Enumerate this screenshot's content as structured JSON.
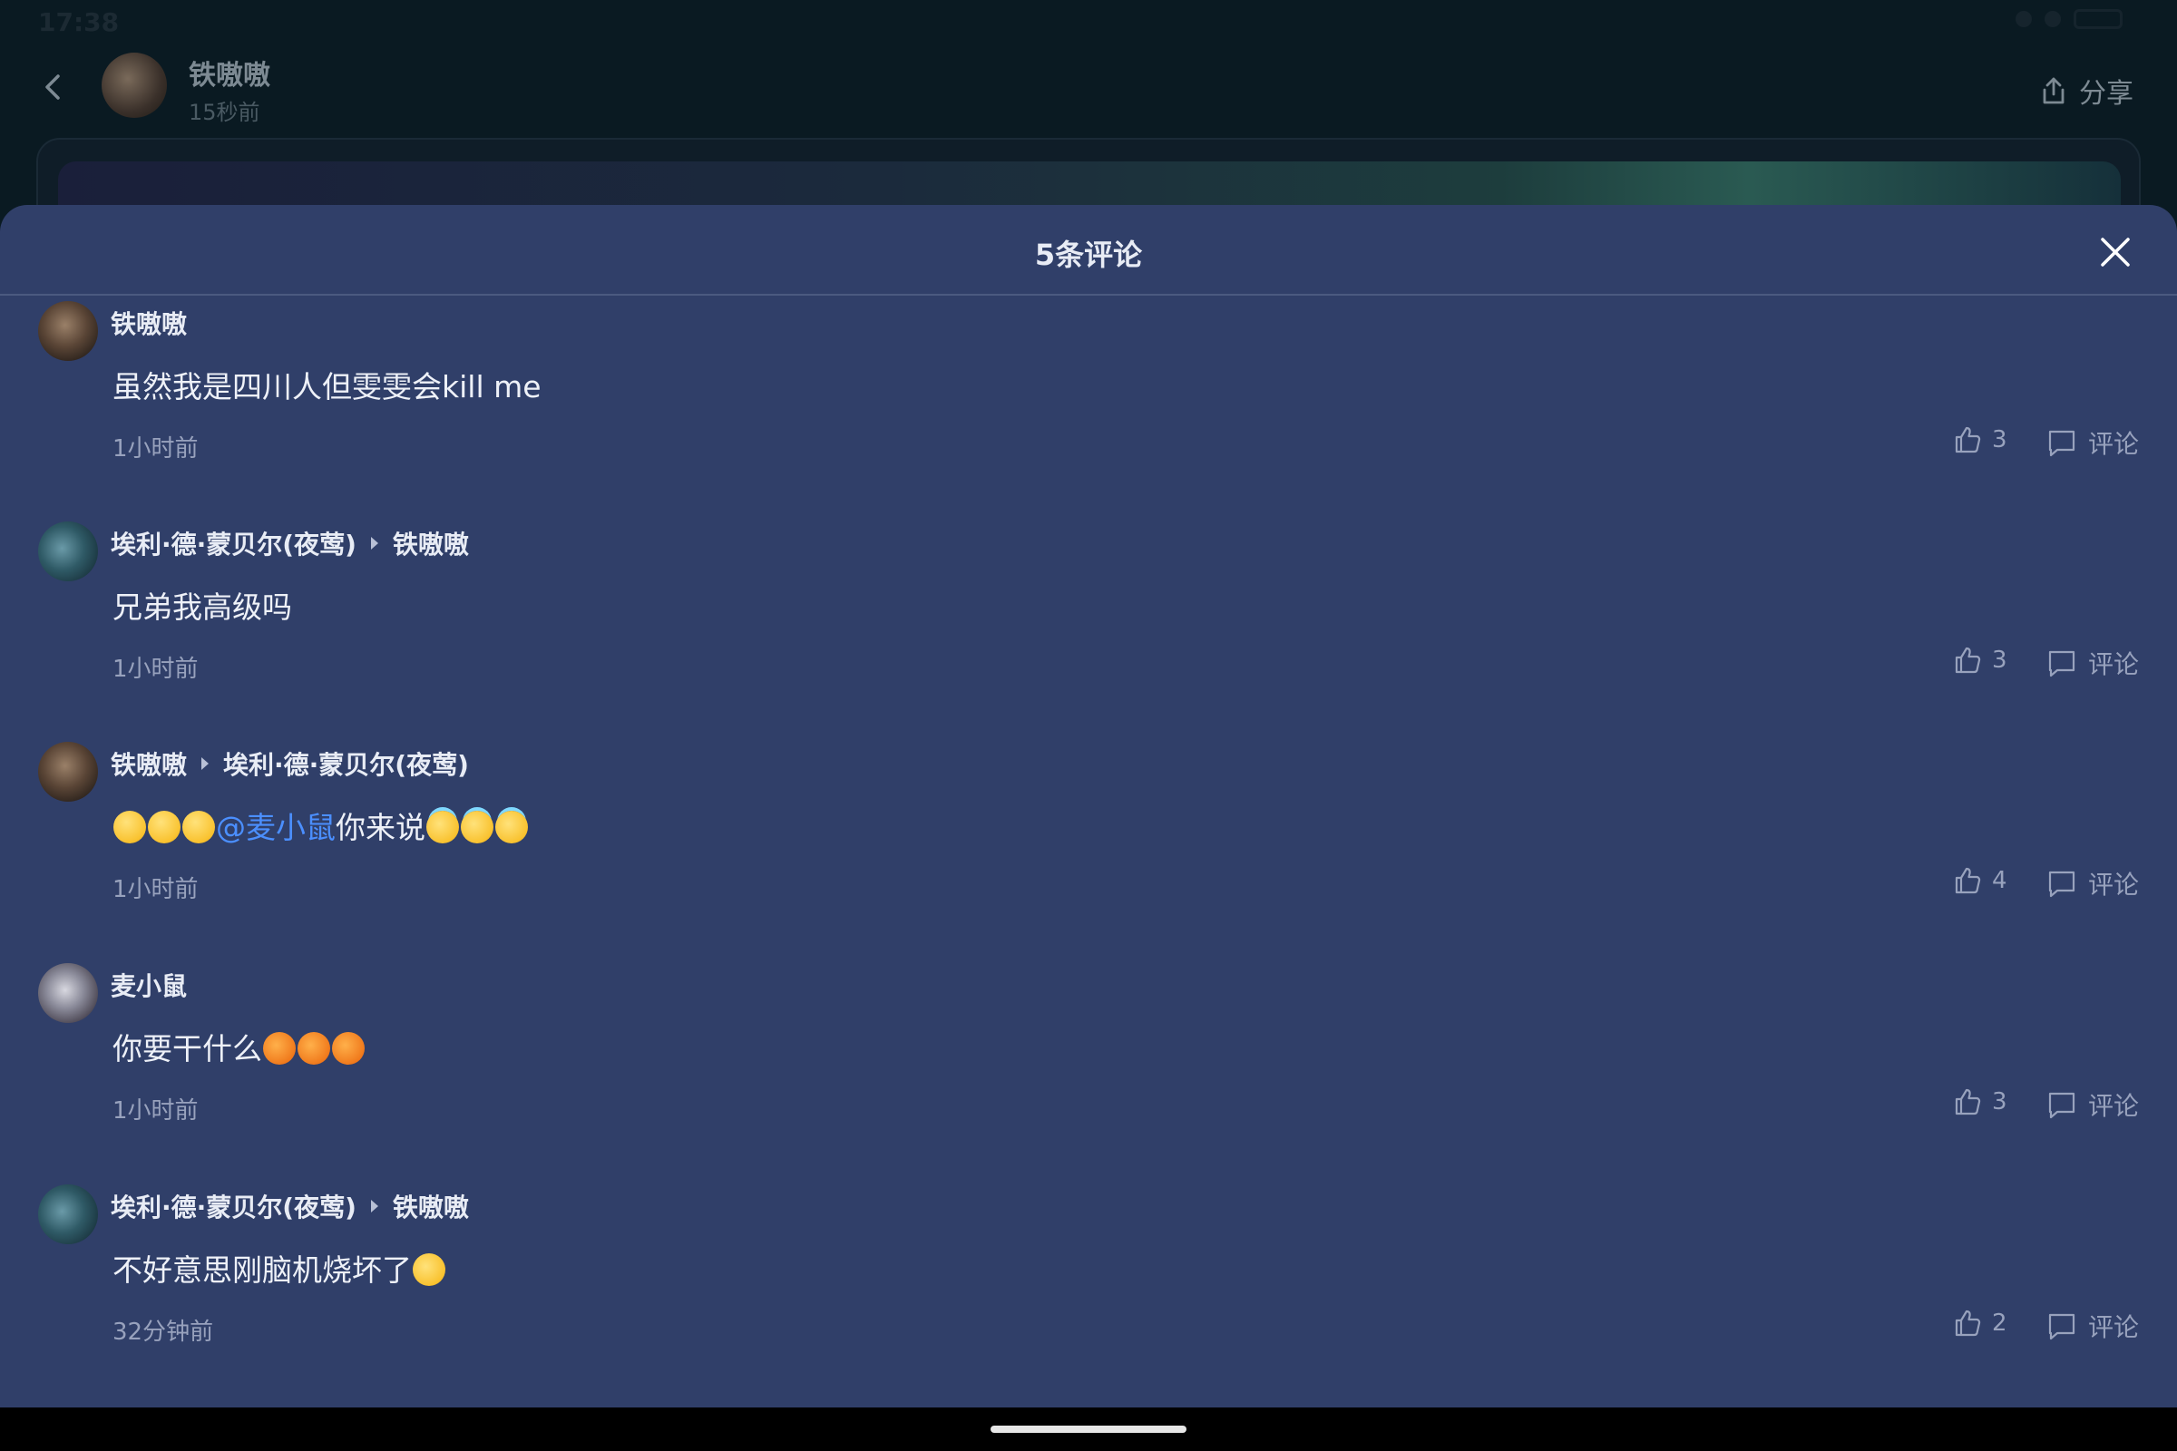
{
  "status_bar": {
    "time": "17:38"
  },
  "post_header": {
    "author": "铁嗷嗷",
    "time": "15秒前",
    "share_label": "分享"
  },
  "sheet": {
    "title": "5条评论"
  },
  "actions": {
    "reply_label": "评论"
  },
  "comments": [
    {
      "author": "铁嗷嗷",
      "reply_to": "",
      "text": "虽然我是四川人但雯雯会kill me",
      "time": "1小时前",
      "likes": "3"
    },
    {
      "author": "埃利·德·蒙贝尔(夜莺)",
      "reply_to": "铁嗷嗷",
      "text": "兄弟我高级吗",
      "time": "1小时前",
      "likes": "3"
    },
    {
      "author": "铁嗷嗷",
      "reply_to": "埃利·德·蒙贝尔(夜莺)",
      "mention": "@麦小鼠",
      "text": "你来说",
      "time": "1小时前",
      "likes": "4"
    },
    {
      "author": "麦小鼠",
      "reply_to": "",
      "text": "你要干什么",
      "time": "1小时前",
      "likes": "3"
    },
    {
      "author": "埃利·德·蒙贝尔(夜莺)",
      "reply_to": "铁嗷嗷",
      "text": "不好意思刚脑机烧坏了",
      "time": "32分钟前",
      "likes": "2"
    }
  ],
  "colors": {
    "sheet_background": "#303f69",
    "mention": "#4b8fff",
    "secondary_text": "#98a2bd"
  }
}
